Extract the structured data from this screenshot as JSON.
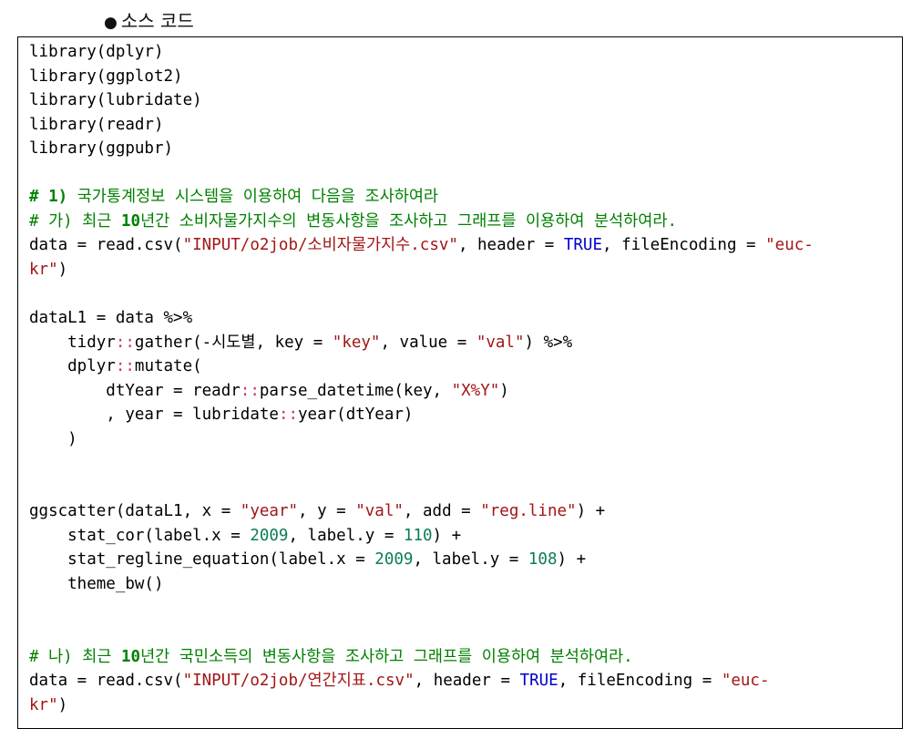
{
  "heading": {
    "bullet": "●",
    "title": "소스 코드"
  },
  "code": {
    "l1": "library(dplyr)",
    "l2": "library(ggplot2)",
    "l3": "library(lubridate)",
    "l4": "library(readr)",
    "l5": "library(ggpubr)",
    "c1a": "# 1)",
    "c1b": " 국가통계정보 시스템을 이용하여 다음을 조사하여라",
    "c2a": "# 가) 최근 ",
    "c2num": "10",
    "c2b": "년간 소비자물가지수의 변동사항을 조사하고 그래프를 이용하여 분석하여라.",
    "d1_pre": "data = read.csv(",
    "d1_str": "\"INPUT/o2job/소비자물가지수.csv\"",
    "d1_mid": ", header = ",
    "d1_kw": "TRUE",
    "d1_mid2": ", fileEncoding = ",
    "d1_str2a": "\"euc-",
    "d1_str2b": "kr\"",
    "d1_close": ")",
    "p1": "dataL1 = data %>%",
    "p2_pre": "    tidyr",
    "p2_ns": "::",
    "p2_mid": "gather(-시도별, key = ",
    "p2_s1": "\"key\"",
    "p2_mid2": ", value = ",
    "p2_s2": "\"val\"",
    "p2_end": ") %>%",
    "p3_pre": "    dplyr",
    "p3_ns": "::",
    "p3_end": "mutate(",
    "p4_pre": "        dtYear = readr",
    "p4_ns": "::",
    "p4_mid": "parse_datetime(key, ",
    "p4_s": "\"X%Y\"",
    "p4_end": ")",
    "p5_pre": "        , year = lubridate",
    "p5_ns": "::",
    "p5_end": "year(dtYear)",
    "p6": "    )",
    "g1_pre": "ggscatter(dataL1, x = ",
    "g1_s1": "\"year\"",
    "g1_mid": ", y = ",
    "g1_s2": "\"val\"",
    "g1_mid2": ", add = ",
    "g1_s3": "\"reg.line\"",
    "g1_end": ") +",
    "g2_pre": "    stat_cor(label.x = ",
    "g2_n1": "2009",
    "g2_mid": ", label.y = ",
    "g2_n2": "110",
    "g2_end": ") +",
    "g3_pre": "    stat_regline_equation(label.x = ",
    "g3_n1": "2009",
    "g3_mid": ", label.y = ",
    "g3_n2": "108",
    "g3_end": ") +",
    "g4": "    theme_bw()",
    "c3a": "# 나) 최근 ",
    "c3num": "10",
    "c3b": "년간 국민소득의 변동사항을 조사하고 그래프를 이용하여 분석하여라.",
    "d2_pre": "data = read.csv(",
    "d2_str": "\"INPUT/o2job/연간지표.csv\"",
    "d2_mid": ", header = ",
    "d2_kw": "TRUE",
    "d2_mid2": ", fileEncoding = ",
    "d2_str2a": "\"euc-",
    "d2_str2b": "kr\"",
    "d2_close": ")"
  },
  "colors": {
    "string": "#a31515",
    "number": "#0b7d55",
    "keyword": "#0000cc",
    "namespace_op": "#cc3366",
    "comment": "#008000"
  }
}
